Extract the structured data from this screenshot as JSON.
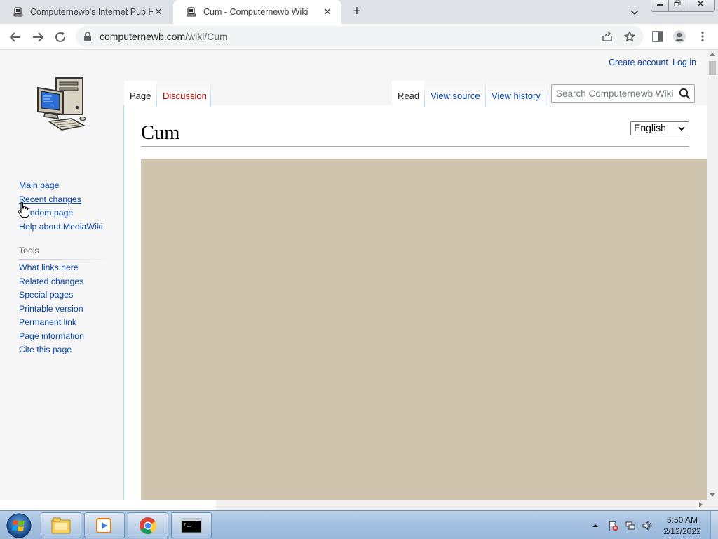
{
  "browser": {
    "tabs": [
      {
        "title": "Computernewb's Internet Pub Hu",
        "active": false
      },
      {
        "title": "Cum - Computernewb Wiki",
        "active": true
      }
    ],
    "close_glyph": "✕",
    "new_tab_glyph": "+",
    "url_host": "computernewb.com",
    "url_path": "/wiki/Cum"
  },
  "wiki": {
    "personal": {
      "create_account": "Create account",
      "log_in": "Log in"
    },
    "navigation": [
      "Main page",
      "Recent changes",
      "Random page",
      "Help about MediaWiki"
    ],
    "tools_heading": "Tools",
    "tools": [
      "What links here",
      "Related changes",
      "Special pages",
      "Printable version",
      "Permanent link",
      "Page information",
      "Cite this page"
    ],
    "namespace_tabs": [
      {
        "label": "Page",
        "selected": true
      },
      {
        "label": "Discussion",
        "selected": false
      }
    ],
    "view_tabs": [
      {
        "label": "Read",
        "selected": true
      },
      {
        "label": "View source",
        "selected": false
      },
      {
        "label": "View history",
        "selected": false
      }
    ],
    "search_placeholder": "Search Computernewb Wiki",
    "page_title": "Cum",
    "language_selected": "English",
    "embed_color": "#cec4ae"
  },
  "taskbar": {
    "time": "5:50 AM",
    "date": "2/12/2022",
    "pinned": [
      "explorer-icon",
      "media-player-icon",
      "chrome-icon",
      "command-prompt-icon"
    ]
  },
  "colors": {
    "link": "#0645ad",
    "new_link": "#ba0000",
    "accent_border": "#a7d7f9"
  }
}
